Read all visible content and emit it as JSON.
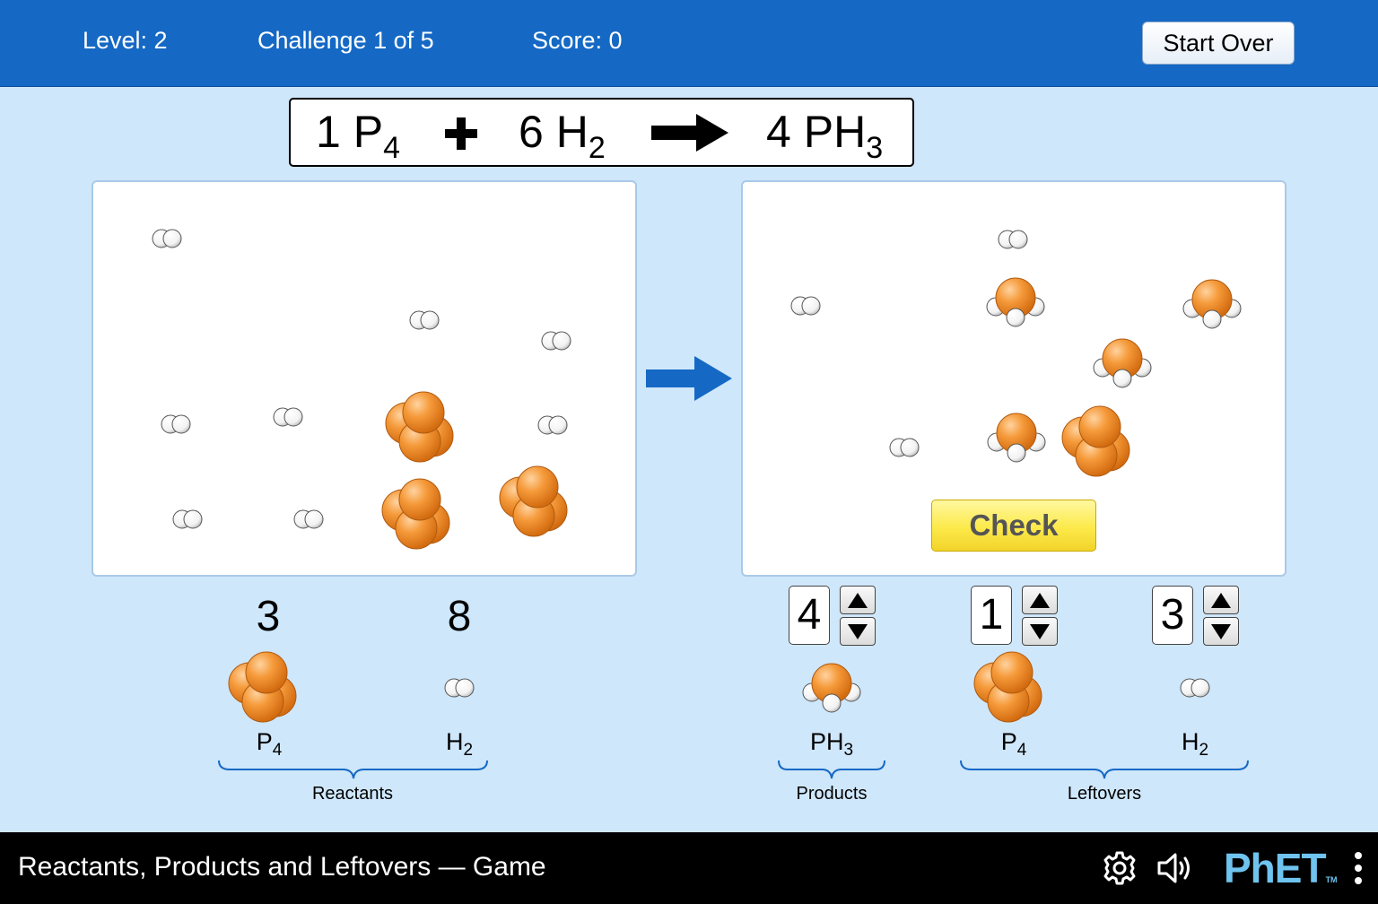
{
  "header": {
    "level": "Level: 2",
    "challenge": "Challenge 1 of 5",
    "score": "Score: 0",
    "start_over_label": "Start Over"
  },
  "equation": {
    "reactant1": {
      "coefficient": "1",
      "element": "P",
      "subscript": "4"
    },
    "plus": "+",
    "reactant2": {
      "coefficient": "6",
      "element": "H",
      "subscript": "2"
    },
    "product": {
      "coefficient": "4",
      "element": "PH",
      "subscript": "3"
    }
  },
  "check_label": "Check",
  "reactants": {
    "items": [
      {
        "count": "3",
        "formula": "P",
        "subscript": "4"
      },
      {
        "count": "8",
        "formula": "H",
        "subscript": "2"
      }
    ],
    "group_label": "Reactants"
  },
  "products": {
    "items": [
      {
        "value": "4",
        "formula": "PH",
        "subscript": "3"
      }
    ],
    "group_label": "Products"
  },
  "leftovers": {
    "items": [
      {
        "value": "1",
        "formula": "P",
        "subscript": "4"
      },
      {
        "value": "3",
        "formula": "H",
        "subscript": "2"
      }
    ],
    "group_label": "Leftovers"
  },
  "footer": {
    "title": "Reactants, Products and Leftovers — Game",
    "logo": "PhET",
    "logo_tm": "TM",
    "icons": [
      "gear-icon",
      "speaker-icon",
      "more-vertical-icon"
    ]
  },
  "colors": {
    "topbar": "#1569c4",
    "background": "#cfe7fb",
    "phosphorus": "#f59a3a",
    "hydrogen": "#ffffff",
    "check_button": "#fce94a",
    "arrow": "#1569c4"
  }
}
